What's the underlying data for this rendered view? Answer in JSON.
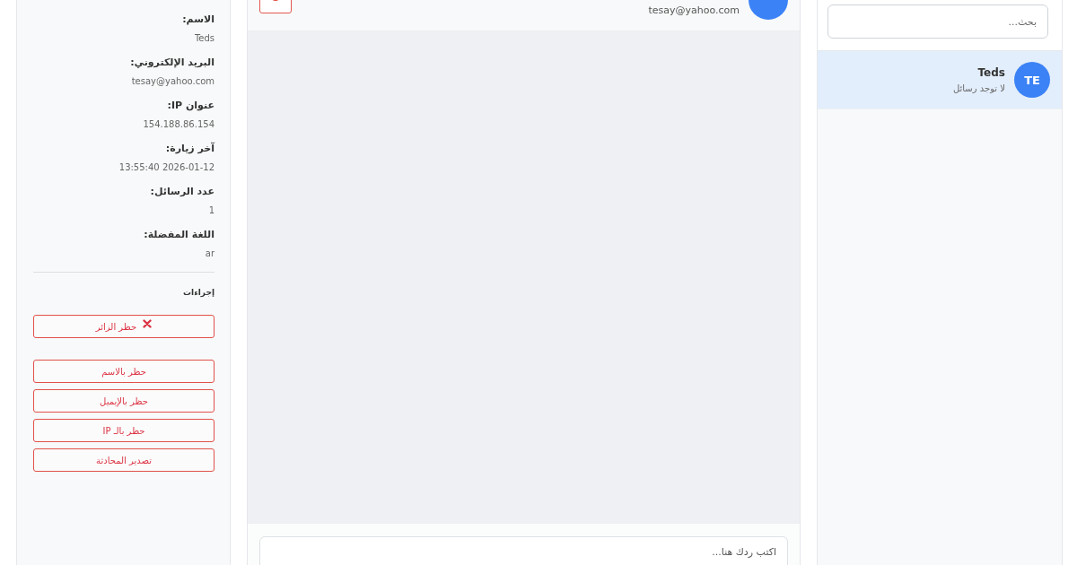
{
  "conversation_list": {
    "search": {
      "placeholder": "بحث..."
    },
    "conversations": [
      {
        "initials": "TE",
        "name": "Teds",
        "preview": "لا توجد رسائل",
        "selected": true
      }
    ]
  },
  "chat": {
    "header": {
      "email": "tesay@yahoo.com"
    },
    "reply": {
      "placeholder": "اكتب ردك هنا..."
    }
  },
  "visitor_info": {
    "fields": [
      {
        "label": "الاسم:",
        "value": "Teds"
      },
      {
        "label": "البريد الإلكتروني:",
        "value": "tesay@yahoo.com"
      },
      {
        "label": "عنوان IP:",
        "value": "154.188.86.154"
      },
      {
        "label": "آخر زيارة:",
        "value": "2026-01-12 13:55:40"
      },
      {
        "label": "عدد الرسائل:",
        "value": "1"
      },
      {
        "label": "اللغة المفضلة:",
        "value": "ar"
      }
    ],
    "actions_title": "إجراءات",
    "actions": [
      {
        "label": "حظر الزائر",
        "kind": "block"
      },
      {
        "label": "حظر بالاسم",
        "kind": "option"
      },
      {
        "label": "حظر بالإيميل",
        "kind": "option"
      },
      {
        "label": "حظر بالـ IP",
        "kind": "option"
      },
      {
        "label": "تصدير المحادثة",
        "kind": "option"
      }
    ]
  }
}
